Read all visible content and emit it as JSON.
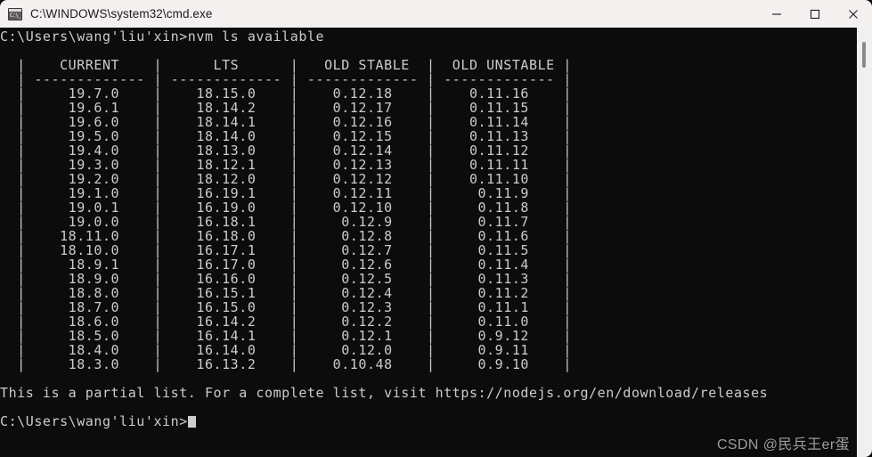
{
  "window": {
    "title": "C:\\WINDOWS\\system32\\cmd.exe",
    "icon": "cmd-icon",
    "icon_glyph": "C:\\_",
    "background_color": "#0c0c0c",
    "foreground_color": "#cccccc",
    "titlebar_color": "#f3f0ef",
    "controls": {
      "minimize": "Minimize",
      "maximize": "Maximize",
      "close": "Close"
    }
  },
  "terminal": {
    "command_line": "C:\\Users\\wang'liu'xin>nvm ls available",
    "prompt": "C:\\Users\\wang'liu'xin>",
    "command": "nvm ls available",
    "table": {
      "top_border": "|",
      "headers": [
        "CURRENT",
        "LTS",
        "OLD STABLE",
        "OLD UNSTABLE"
      ],
      "separator": "---------------",
      "rows": [
        [
          "19.7.0",
          "18.15.0",
          "0.12.18",
          "0.11.16"
        ],
        [
          "19.6.1",
          "18.14.2",
          "0.12.17",
          "0.11.15"
        ],
        [
          "19.6.0",
          "18.14.1",
          "0.12.16",
          "0.11.14"
        ],
        [
          "19.5.0",
          "18.14.0",
          "0.12.15",
          "0.11.13"
        ],
        [
          "19.4.0",
          "18.13.0",
          "0.12.14",
          "0.11.12"
        ],
        [
          "19.3.0",
          "18.12.1",
          "0.12.13",
          "0.11.11"
        ],
        [
          "19.2.0",
          "18.12.0",
          "0.12.12",
          "0.11.10"
        ],
        [
          "19.1.0",
          "16.19.1",
          "0.12.11",
          "0.11.9"
        ],
        [
          "19.0.1",
          "16.19.0",
          "0.12.10",
          "0.11.8"
        ],
        [
          "19.0.0",
          "16.18.1",
          "0.12.9",
          "0.11.7"
        ],
        [
          "18.11.0",
          "16.18.0",
          "0.12.8",
          "0.11.6"
        ],
        [
          "18.10.0",
          "16.17.1",
          "0.12.7",
          "0.11.5"
        ],
        [
          "18.9.1",
          "16.17.0",
          "0.12.6",
          "0.11.4"
        ],
        [
          "18.9.0",
          "16.16.0",
          "0.12.5",
          "0.11.3"
        ],
        [
          "18.8.0",
          "16.15.1",
          "0.12.4",
          "0.11.2"
        ],
        [
          "18.7.0",
          "16.15.0",
          "0.12.3",
          "0.11.1"
        ],
        [
          "18.6.0",
          "16.14.2",
          "0.12.2",
          "0.11.0"
        ],
        [
          "18.5.0",
          "16.14.1",
          "0.12.1",
          "0.9.12"
        ],
        [
          "18.4.0",
          "16.14.0",
          "0.12.0",
          "0.9.11"
        ],
        [
          "18.3.0",
          "16.13.2",
          "0.10.48",
          "0.9.10"
        ]
      ]
    },
    "footer_note": "This is a partial list. For a complete list, visit https://nodejs.org/en/download/releases",
    "final_prompt": "C:\\Users\\wang'liu'xin>",
    "cursor": "block-cursor"
  },
  "scrollbar": {
    "name": "vertical-scrollbar",
    "thumb": "scroll-thumb"
  },
  "watermark": {
    "text": "CSDN @民兵王er蛋"
  }
}
